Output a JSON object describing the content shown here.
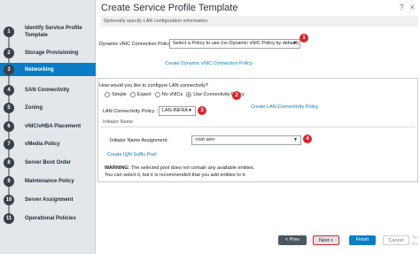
{
  "window": {
    "title": "Create Service Profile Template",
    "help_icon": "?",
    "close_icon": "×"
  },
  "sidebar": {
    "steps": [
      {
        "num": "1",
        "label": "Identify Service Profile Template",
        "active": false
      },
      {
        "num": "2",
        "label": "Storage Provisioning",
        "active": false
      },
      {
        "num": "3",
        "label": "Networking",
        "active": true
      },
      {
        "num": "4",
        "label": "SAN Connectivity",
        "active": false
      },
      {
        "num": "5",
        "label": "Zoning",
        "active": false
      },
      {
        "num": "6",
        "label": "vNIC/vHBA Placement",
        "active": false
      },
      {
        "num": "7",
        "label": "vMedia Policy",
        "active": false
      },
      {
        "num": "8",
        "label": "Server Boot Order",
        "active": false
      },
      {
        "num": "9",
        "label": "Maintenance Policy",
        "active": false
      },
      {
        "num": "10",
        "label": "Server Assignment",
        "active": false
      },
      {
        "num": "11",
        "label": "Operational Policies",
        "active": false
      }
    ]
  },
  "main": {
    "subtitle": "Optionally specify LAN configuration information.",
    "dynamic_vnic": {
      "label": "Dynamic vNIC Connection Policy:",
      "value": "Select a Policy to use (no Dynamic vNIC Policy by default)",
      "badge": "1",
      "create_link": "Create Dynamic vNIC Connection Policy"
    },
    "lan_config": {
      "question": "How would you like to configure LAN connectivity?",
      "options": [
        "Simple",
        "Expert",
        "No vNICs",
        "Use Connectivity Policy"
      ],
      "selected_index": 3,
      "badge": "2",
      "lcp_label": "LAN Connectivity Policy :",
      "lcp_value": "LAN-INFRA",
      "lcp_badge": "3",
      "create_lcp_link": "Create LAN Connectivity Policy"
    },
    "initiator": {
      "section": "Initiator Name",
      "label": "Initiator Name Assignment:",
      "value": "<not set>",
      "badge": "4",
      "create_link": "Create IQN Suffix Pool"
    },
    "warning": {
      "bold": "WARNING:",
      "text": " The selected pool does not contain any available entities.",
      "line2": "You can select it, but it is recommended that you add entities to it."
    }
  },
  "footer": {
    "prev": "< Prev",
    "next": "Next >",
    "finish": "Finish",
    "cancel": "Cancel",
    "watermark_1": "Ac",
    "watermark_2": "Go"
  },
  "colors": {
    "accent": "#0a7dc6",
    "badge": "#d8262f",
    "sidebar_bg": "#e3e7ea"
  }
}
